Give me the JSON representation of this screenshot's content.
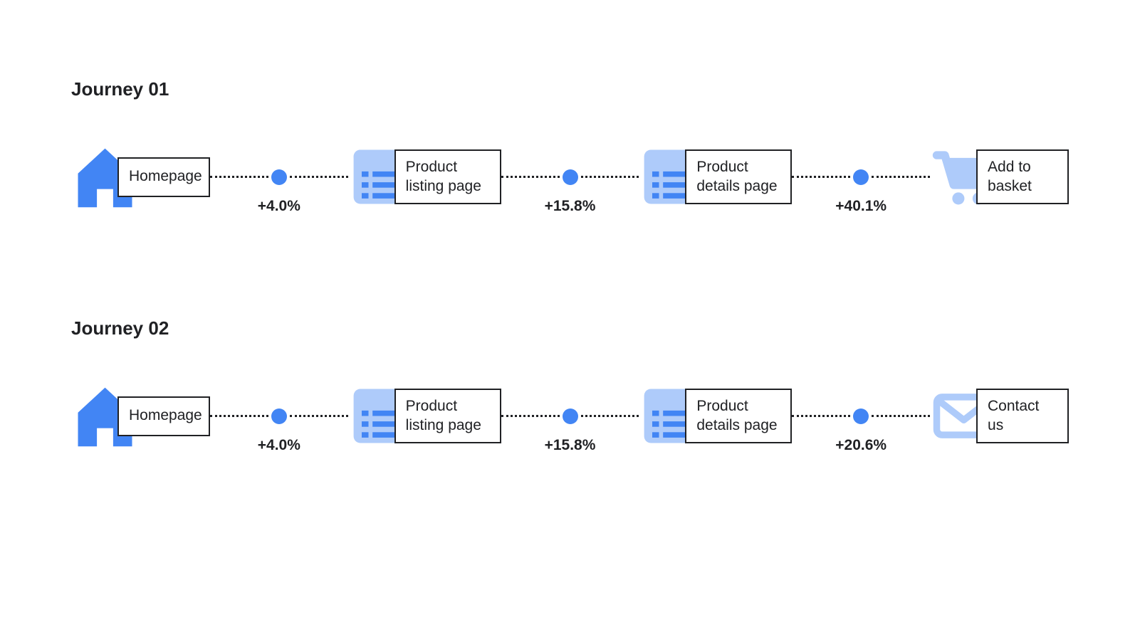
{
  "colors": {
    "icon_primary": "#4285f4",
    "icon_light": "#aecbfa",
    "text": "#202124"
  },
  "journeys": [
    {
      "title": "Journey 01",
      "steps": [
        {
          "icon": "home",
          "label": "Homepage"
        },
        {
          "icon": "browser-list",
          "label": "Product listing page"
        },
        {
          "icon": "browser-list",
          "label": "Product details page"
        },
        {
          "icon": "cart",
          "label": "Add to basket"
        }
      ],
      "connectors": [
        "+4.0%",
        "+15.8%",
        "+40.1%"
      ]
    },
    {
      "title": "Journey 02",
      "steps": [
        {
          "icon": "home",
          "label": "Homepage"
        },
        {
          "icon": "browser-list",
          "label": "Product listing page"
        },
        {
          "icon": "browser-list",
          "label": "Product details page"
        },
        {
          "icon": "envelope",
          "label": "Contact us"
        }
      ],
      "connectors": [
        "+4.0%",
        "+15.8%",
        "+20.6%"
      ]
    }
  ]
}
